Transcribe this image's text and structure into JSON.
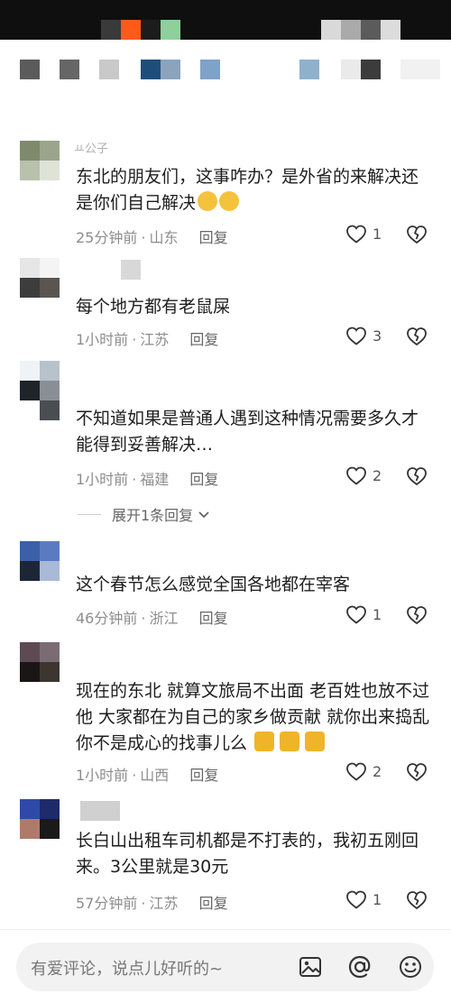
{
  "comments": [
    {
      "text": "东北的朋友们，这事咋办？是外省的来解决还是你们自己解决",
      "username_fragment": "ㅛ公子",
      "time": "25分钟前",
      "location": "山东",
      "reply_label": "回复",
      "likes": "1"
    },
    {
      "text": "每个地方都有老鼠屎",
      "time": "1小时前",
      "location": "江苏",
      "reply_label": "回复",
      "likes": "3"
    },
    {
      "text": "不知道如果是普通人遇到这种情况需要多久才能得到妥善解决…",
      "time": "1小时前",
      "location": "福建",
      "reply_label": "回复",
      "likes": "2",
      "expand_label": "展开1条回复"
    },
    {
      "text": "这个春节怎么感觉全国各地都在宰客",
      "time": "46分钟前",
      "location": "浙江",
      "reply_label": "回复",
      "likes": "1"
    },
    {
      "text": "现在的东北 就算文旅局不出面 老百姓也放不过他 大家都在为自己的家乡做贡献 就你出来捣乱 你不是成心的找事儿么",
      "time": "1小时前",
      "location": "山西",
      "reply_label": "回复",
      "likes": "2"
    },
    {
      "text": "长白山出租车司机都是不打表的，我初五刚回来。3公里就是30元",
      "time": "57分钟前",
      "location": "江苏",
      "reply_label": "回复",
      "likes": "1"
    }
  ],
  "input": {
    "placeholder": "有爱评论，说点儿好听的~"
  },
  "icons": {
    "like": "heart-outline-icon",
    "dislike": "broken-heart-icon",
    "image": "image-icon",
    "mention": "at-icon",
    "emoji": "smiley-icon"
  }
}
